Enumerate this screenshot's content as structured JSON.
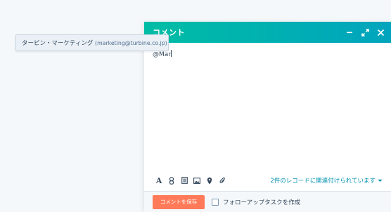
{
  "suggestion": {
    "name": "タービン・マーケティング",
    "email": "(marketing@turbine.co.jp)"
  },
  "panel": {
    "title": "コメント",
    "editor_text": "@Mar",
    "association_link": "2件のレコードに関連付けられています",
    "save_label": "コメントを保存",
    "follow_up_label": "フォローアップタスクを作成"
  },
  "colors": {
    "header_gradient_start": "#00bda5",
    "header_gradient_end": "#00a4bd",
    "save_button": "#ff7a59",
    "link": "#0091ae"
  },
  "icons": {
    "toolbar": [
      "text-format-icon",
      "link-icon",
      "snippet-icon",
      "image-icon",
      "location-icon",
      "attachment-icon"
    ],
    "window": [
      "minimize-icon",
      "expand-icon",
      "close-icon"
    ]
  }
}
